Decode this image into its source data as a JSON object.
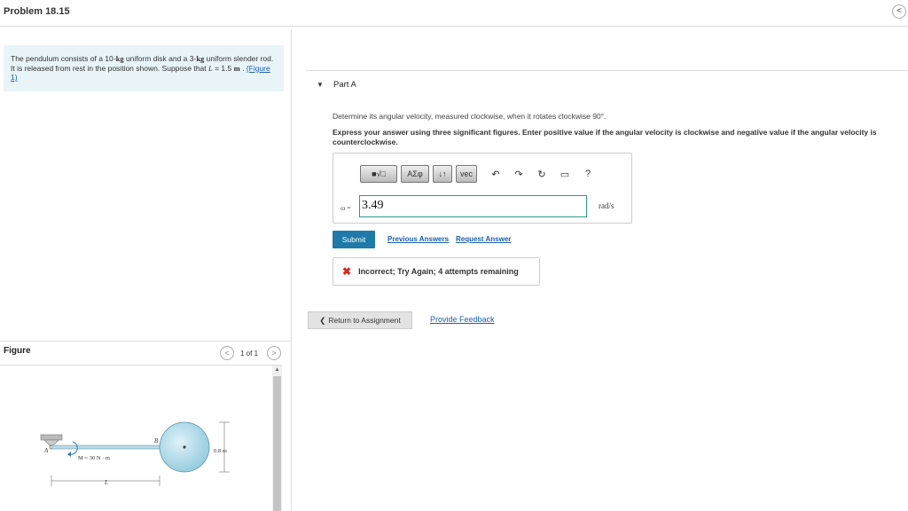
{
  "header": {
    "title": "Problem 18.15",
    "collapse_glyph": "<"
  },
  "problem": {
    "text_1": "The pendulum consists of a 10-",
    "unit_kg_1": "kg",
    "text_2": " uniform disk and a 3-",
    "unit_kg_2": "kg",
    "text_3": " uniform slender rod. It is released from rest in the position shown. Suppose that ",
    "var_L": "L",
    "text_4": " = 1.5 ",
    "unit_m": "m",
    "text_5": " . ",
    "figure_link": "(Figure 1)"
  },
  "part": {
    "caret": "▼",
    "label": "Part A"
  },
  "question": "Determine its angular velocity, measured clockwise, when it rotates clockwise 90°.",
  "instructions": "Express your answer using three significant figures. Enter positive value if the angular velocity is clockwise and negative value if the angular velocity is counterclockwise.",
  "toolbar": {
    "templates_label": "■√□",
    "greek_label": "ΑΣφ",
    "updown_label": "↓↑",
    "vec_label": "vec",
    "undo_glyph": "↶",
    "redo_glyph": "↷",
    "reset_glyph": "↻",
    "keyboard_glyph": "▭",
    "help_glyph": "?"
  },
  "answer": {
    "variable": "ω =",
    "value": "3.49",
    "unit": "rad/s"
  },
  "actions": {
    "submit_label": "Submit",
    "previous_answers": "Previous Answers",
    "request_answer": "Request Answer"
  },
  "feedback": {
    "icon_glyph": "✖",
    "message": "Incorrect; Try Again; 4 attempts remaining"
  },
  "footer": {
    "return_label": "Return to Assignment",
    "provide_feedback": "Provide Feedback"
  },
  "figure": {
    "title": "Figure",
    "prev_glyph": "<",
    "next_glyph": ">",
    "counter": "1 of 1",
    "label_A": "A",
    "label_B": "B",
    "label_moment": "M = 30 N · m",
    "label_L": "L",
    "label_diameter": "0.8 m"
  },
  "colors": {
    "accent": "#1e7aa8",
    "link": "#1a5fb4",
    "error": "#d62828",
    "problem_bg": "#e8f4f8"
  }
}
